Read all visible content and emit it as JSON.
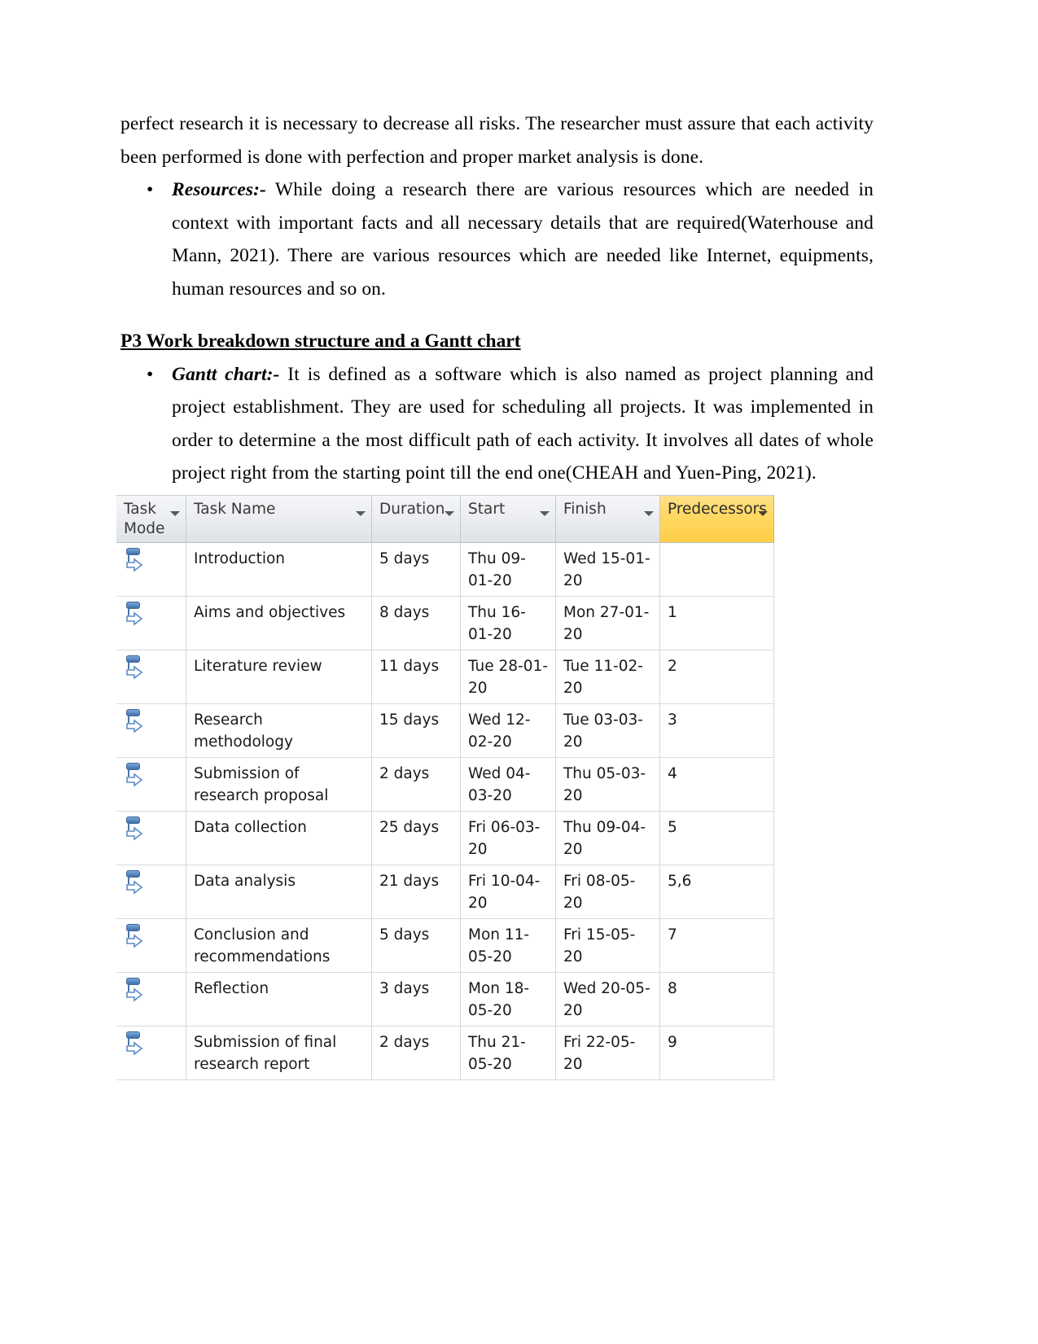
{
  "document": {
    "paragraphs": [
      {
        "id": "p-continuation",
        "type": "plain",
        "text": "perfect research it is necessary to decrease all risks. The researcher must assure that each activity been performed is done with perfection and proper market analysis is done."
      },
      {
        "id": "p-resources",
        "type": "bullet",
        "bullet": "•",
        "lead": "Resources:-",
        "text": " While doing a research there are various resources which are needed in context with important facts and all necessary details that are required(Waterhouse and Mann,  2021). There are various resources which are needed like Internet, equipments, human resources and so on."
      }
    ],
    "heading": "P3 Work breakdown structure and a Gantt chart ",
    "paragraphs_after_heading": [
      {
        "id": "p-gantt",
        "type": "bullet",
        "bullet": "•",
        "lead": "Gantt chart:-",
        "text": " It is defined as a software which is also named as project planning and project establishment. They are used for scheduling all projects. It was implemented in order to determine a the most difficult path of each activity. It involves all dates of whole project right from the starting point till the end one(CHEAH and Yuen-Ping,  2021)."
      }
    ]
  },
  "gantt_table": {
    "highlight_color": "#ffd864",
    "header_color": "#e6e9ed",
    "columns": [
      {
        "key": "task_mode",
        "label": "Task Mode",
        "has_filter": true,
        "highlighted": false
      },
      {
        "key": "task_name",
        "label": "Task Name",
        "has_filter": true,
        "highlighted": false
      },
      {
        "key": "duration",
        "label": "Duration",
        "has_filter": true,
        "highlighted": false
      },
      {
        "key": "start",
        "label": "Start",
        "has_filter": true,
        "highlighted": false
      },
      {
        "key": "finish",
        "label": "Finish",
        "has_filter": true,
        "highlighted": false
      },
      {
        "key": "predecessors",
        "label": "Predecessors",
        "has_filter": true,
        "highlighted": true
      }
    ],
    "row_mode_icon": "auto-scheduled-icon",
    "rows": [
      {
        "n": 1,
        "task_mode": "auto-scheduled-icon",
        "task_name": "Introduction",
        "duration": "5 days",
        "start": "Thu 09-01-20",
        "finish": "Wed 15-01-20",
        "predecessors": ""
      },
      {
        "n": 2,
        "task_mode": "auto-scheduled-icon",
        "task_name": "Aims and objectives",
        "duration": "8 days",
        "start": "Thu 16-01-20",
        "finish": "Mon 27-01-20",
        "predecessors": "1"
      },
      {
        "n": 3,
        "task_mode": "auto-scheduled-icon",
        "task_name": "Literature review",
        "duration": "11 days",
        "start": "Tue 28-01-20",
        "finish": "Tue 11-02-20",
        "predecessors": "2"
      },
      {
        "n": 4,
        "task_mode": "auto-scheduled-icon",
        "task_name": "Research methodology",
        "duration": "15 days",
        "start": "Wed 12-02-20",
        "finish": "Tue 03-03-20",
        "predecessors": "3"
      },
      {
        "n": 5,
        "task_mode": "auto-scheduled-icon",
        "task_name": "Submission of research proposal",
        "duration": "2 days",
        "start": "Wed 04-03-20",
        "finish": "Thu 05-03-20",
        "predecessors": "4"
      },
      {
        "n": 6,
        "task_mode": "auto-scheduled-icon",
        "task_name": "Data collection",
        "duration": "25 days",
        "start": "Fri 06-03-20",
        "finish": "Thu 09-04-20",
        "predecessors": "5"
      },
      {
        "n": 7,
        "task_mode": "auto-scheduled-icon",
        "task_name": "Data analysis",
        "duration": "21 days",
        "start": "Fri 10-04-20",
        "finish": "Fri 08-05-20",
        "predecessors": "5,6"
      },
      {
        "n": 8,
        "task_mode": "auto-scheduled-icon",
        "task_name": "Conclusion and recommendations",
        "duration": "5 days",
        "start": "Mon 11-05-20",
        "finish": "Fri 15-05-20",
        "predecessors": "7"
      },
      {
        "n": 9,
        "task_mode": "auto-scheduled-icon",
        "task_name": "Reflection",
        "duration": "3 days",
        "start": "Mon 18-05-20",
        "finish": "Wed 20-05-20",
        "predecessors": "8"
      },
      {
        "n": 10,
        "task_mode": "auto-scheduled-icon",
        "task_name": "Submission of final research report",
        "duration": "2 days",
        "start": "Thu 21-05-20",
        "finish": "Fri 22-05-20",
        "predecessors": "9"
      }
    ]
  }
}
